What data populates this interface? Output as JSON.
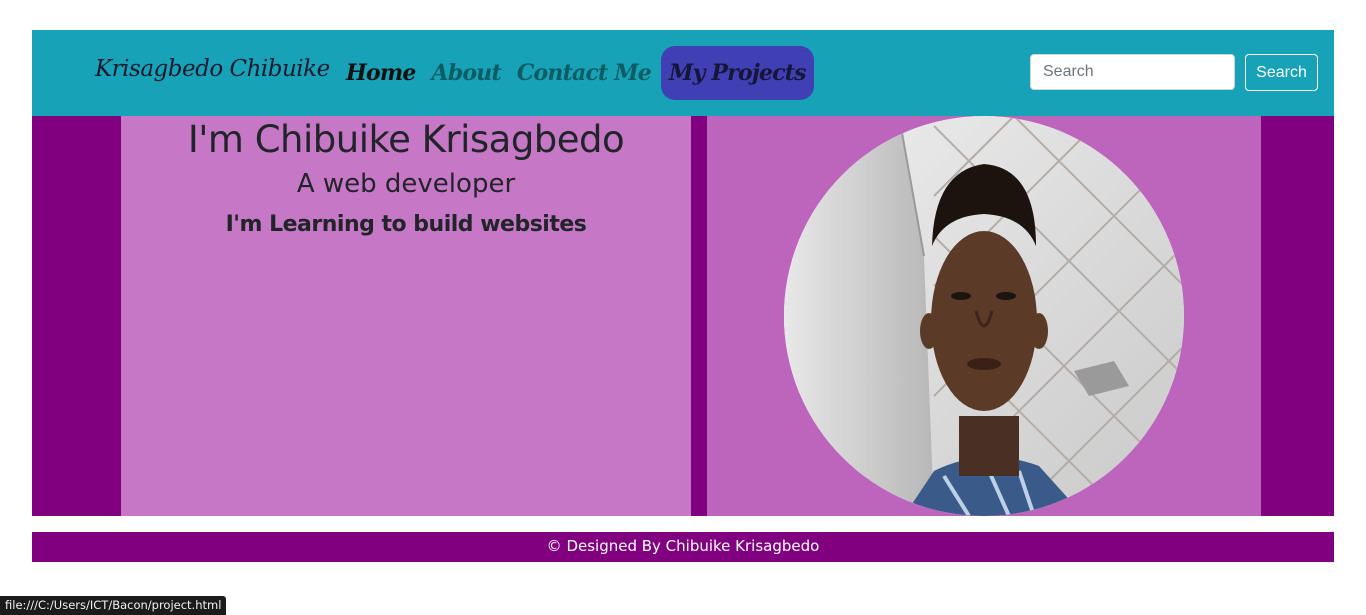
{
  "navbar": {
    "brand": "Krisagbedo Chibuike",
    "links": [
      {
        "label": "Home"
      },
      {
        "label": "About"
      },
      {
        "label": "Contact Me"
      },
      {
        "label": "My Projects"
      }
    ],
    "search": {
      "placeholder": "Search",
      "value": "",
      "button_label": "Search"
    }
  },
  "hero": {
    "headline": "I'm Chibuike Krisagbedo",
    "subheadline": "A web developer",
    "tagline": "I'm Learning to build websites",
    "photo_icon": "person-photo"
  },
  "footer": {
    "text": "© Designed By Chibuike Krisagbedo"
  },
  "status_bar": {
    "url": "file:///C:/Users/ICT/Bacon/project.html"
  },
  "colors": {
    "navbar_bg": "#17a2b8",
    "hero_bg": "#800080",
    "left_panel_bg": "#c678c6",
    "right_panel_bg": "#bd64bd",
    "active_link_bg": "#4040b4",
    "footer_bg": "#800080"
  }
}
